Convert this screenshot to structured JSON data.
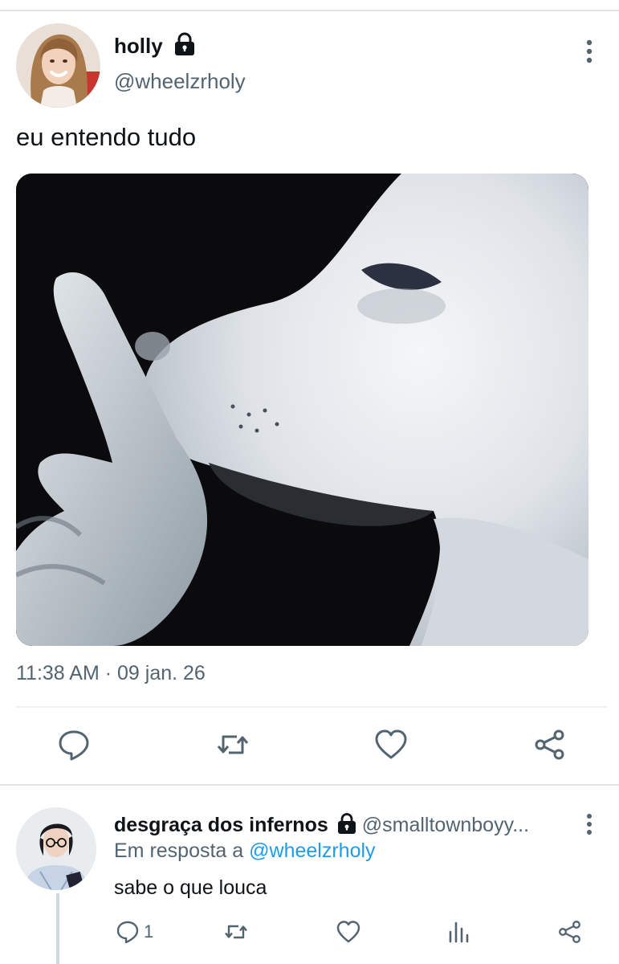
{
  "tweet": {
    "display_name": "holly",
    "handle": "@wheelzrholy",
    "text": "eu entendo tudo",
    "time": "11:38 AM",
    "separator": "·",
    "date": "09 jan. 26",
    "media_icon": "dog-finger-on-lips-photo",
    "actions": [
      "reply-icon",
      "retweet-icon",
      "like-icon",
      "share-icon"
    ]
  },
  "reply": {
    "display_name": "desgraça dos infernos",
    "handle": "@smalltownboyy...",
    "reply_prefix": "Em resposta a",
    "mention": "@wheelzrholy",
    "text": "sabe o que louca",
    "reply_count": "1",
    "actions": [
      "reply-icon",
      "retweet-icon",
      "like-icon",
      "analytics-icon",
      "share-icon"
    ]
  },
  "colors": {
    "text_primary": "#0f1419",
    "text_secondary": "#536471",
    "accent": "#1d9bf0",
    "divider": "#e1e4e6"
  }
}
